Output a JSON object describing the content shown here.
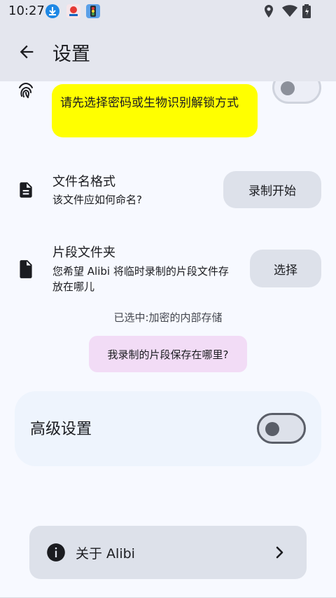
{
  "status_bar": {
    "time": "10:27",
    "app_icons": [
      "download-icon",
      "app-icon",
      "traffic-light-icon"
    ],
    "right_icons": [
      "location-icon",
      "wifi-icon",
      "battery-icon"
    ]
  },
  "app_bar": {
    "title": "设置",
    "back_icon": "arrow-back-icon"
  },
  "security": {
    "tooltip": "请先选择密码或生物识别解锁方式",
    "icon": "fingerprint-icon",
    "toggle_on": false
  },
  "filename_format": {
    "title": "文件名格式",
    "subtitle": "该文件应如何命名?",
    "button_label": "录制开始",
    "icon": "document-text-icon"
  },
  "clip_folder": {
    "title": "片段文件夹",
    "subtitle": "您希望 Alibi 将临时录制的片段文件存放在哪儿",
    "button_label": "选择",
    "icon": "document-icon",
    "selected_caption": "已选中:加密的内部存储",
    "tooltip": "我录制的片段保存在哪里?"
  },
  "advanced": {
    "label": "高级设置",
    "toggle_on": false
  },
  "about": {
    "label": "关于 Alibi",
    "icon": "info-icon",
    "chevron": "chevron-right-icon"
  },
  "colors": {
    "app_bar": "#e4e6ee",
    "background": "#f7f9ff",
    "yellow_tooltip": "#ffff00",
    "pink_tooltip": "#f2dcf6",
    "tonal_button": "#dde1ea"
  }
}
